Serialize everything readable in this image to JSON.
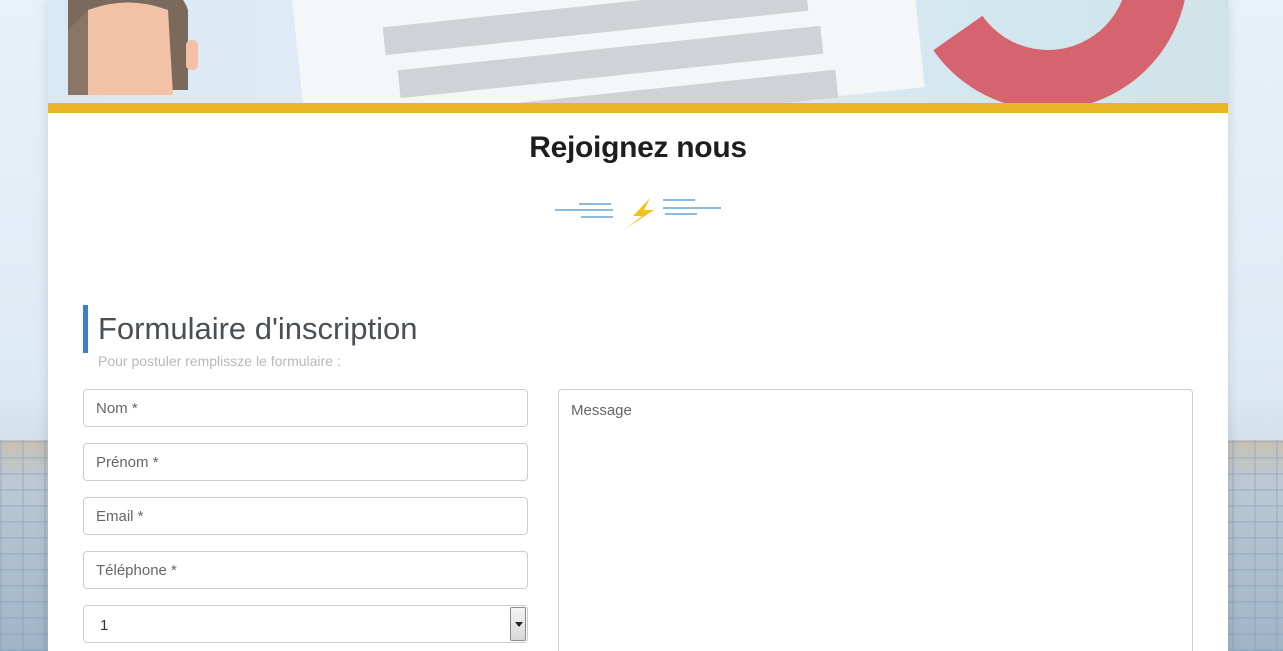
{
  "header": {
    "title": "Rejoignez nous"
  },
  "form": {
    "title": "Formulaire d'inscription",
    "subtitle": "Pour postuler remplissze le formulaire :",
    "nom_placeholder": "Nom *",
    "prenom_placeholder": "Prénom *",
    "email_placeholder": "Email *",
    "telephone_placeholder": "Téléphone *",
    "select_value": "1",
    "message_placeholder": "Message"
  },
  "colors": {
    "accent_bar": "#e9b425",
    "section_border": "#3c82c3",
    "lightning": "#f2c21a",
    "divider_lines": "#4a90c8"
  },
  "icons": {
    "divider": "lightning-bolt-icon",
    "select_arrow": "chevron-down-icon"
  }
}
